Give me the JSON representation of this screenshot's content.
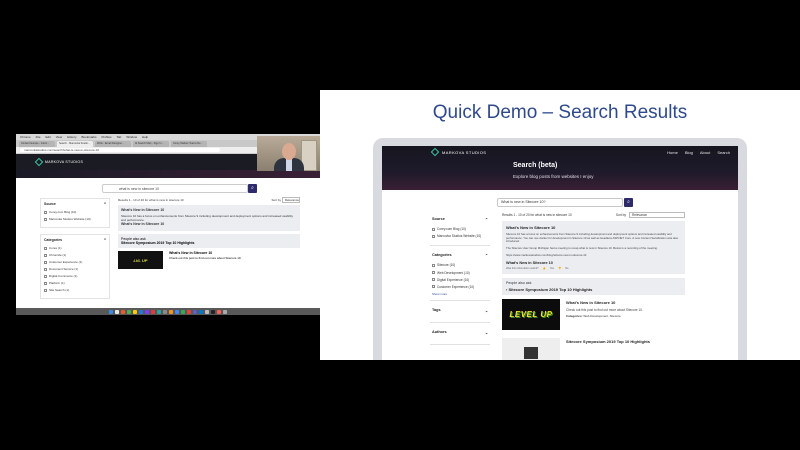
{
  "slide": {
    "title": "Quick Demo – Search Results"
  },
  "site": {
    "brand": "MARKOVA STUDIOS",
    "nav": [
      "Home",
      "Blog",
      "About",
      "Search"
    ],
    "hero_title": "Search (beta)",
    "hero_subtitle": "Explore blog posts from websites I enjoy",
    "search": {
      "value": "What is new in Sitecore 10?",
      "button_icon": "search-icon"
    },
    "results_summary": "Results 1 - 10 of 20 for what is new in sitecore 10",
    "sort_label": "Sort by",
    "sort_value": "Relevance",
    "facets": {
      "source": {
        "title": "Source",
        "items": [
          "Corey.com Blog (10)",
          "Marcovka Studios Website (10)"
        ]
      },
      "categories": {
        "title": "Categories",
        "items": [
          "Sitecore (10)",
          "Web Development (10)",
          "Digital Experience (10)",
          "Customer Experience (10)"
        ],
        "more": "Show more"
      },
      "tags": {
        "title": "Tags"
      },
      "authors": {
        "title": "Authors"
      }
    },
    "featured": {
      "title": "What's New in Sitecore 10",
      "para1": "Sitecore 10 has a focus on enhancements from Sitecore 9 including development and deployment options and increased usability and performance. You can use docker for development in Sitecore 10 as well as Headless ASP.NET Core. A new Content Serialization was also introduced.",
      "para2": "The Sitecore User Group Michigan had a meeting to recap what is new in Sitecore 10. Below is a recording of the meeting.",
      "url": "https://www.markovastudios.com/blog/what-is-new-in-sitecore-10",
      "link": "What's New in Sitecore 10",
      "helpful": "Was this information useful?",
      "yes": "Yes",
      "no": "No"
    },
    "people_also_ask": {
      "title": "People also ask",
      "item": "Sitecore Symposium 2019 Top 10 Highlights"
    },
    "results": [
      {
        "title": "What's New in Sitecore 10",
        "desc": "Check out this post to find out more about Sitecore 10.",
        "category_label": "Categories:",
        "category_value": "Web Development, Sitecore",
        "thumb_text": "LEVEL UP"
      },
      {
        "title": "Sitecore Symposium 2019 Top 10 Highlights",
        "desc": "",
        "category_label": "",
        "category_value": "",
        "thumb_text": ""
      }
    ]
  },
  "screen_share": {
    "menubar": [
      "Chrome",
      "File",
      "Edit",
      "View",
      "History",
      "Bookmarks",
      "Profiles",
      "Tab",
      "Window",
      "Help"
    ],
    "tabs": [
      "Content Europe - Intern...",
      "Search - Marcovka Studio...",
      "Work - Email Designer...",
      "Ai Search Map - Sign In...",
      "Corey Markov Teams De..."
    ],
    "url": "marcovkastudios.com/search/what-is-new-in-sitecore-10",
    "mini_nav": [
      "Home",
      "Blog"
    ],
    "search_value": "what is new in sitecore 10",
    "results_summary": "Results 1 - 10 of 20 for what is new in sitecore 10",
    "sort_label": "Sort by",
    "sort_value": "Relevance",
    "source_title": "Source",
    "source_items": [
      "Corey.com Blog (10)",
      "Marcovka Studios Website (10)"
    ],
    "categories_title": "Categories",
    "categories_items": [
      "Cores (1)",
      "Chronicle (1)",
      "Customer Experience (1)",
      "Document Service (1)",
      "Digital Commerce (1)",
      "Platform (1)",
      "Site Search (1)"
    ],
    "featured_title": "What's New in Sitecore 10",
    "featured_text": "Sitecore 10 has a focus on enhancements from Sitecore 9 including development and deployment options and increased usability and performance.",
    "featured_link": "What's New in Sitecore 10",
    "pao_title": "People also ask",
    "pao_item": "Sitecore Symposium 2019 Top 10 Highlights",
    "result_title": "What's New in Sitecore 10",
    "result_desc": "Check out this post to find out more about Sitecore 10.",
    "thumb_text": "LVL UP"
  }
}
